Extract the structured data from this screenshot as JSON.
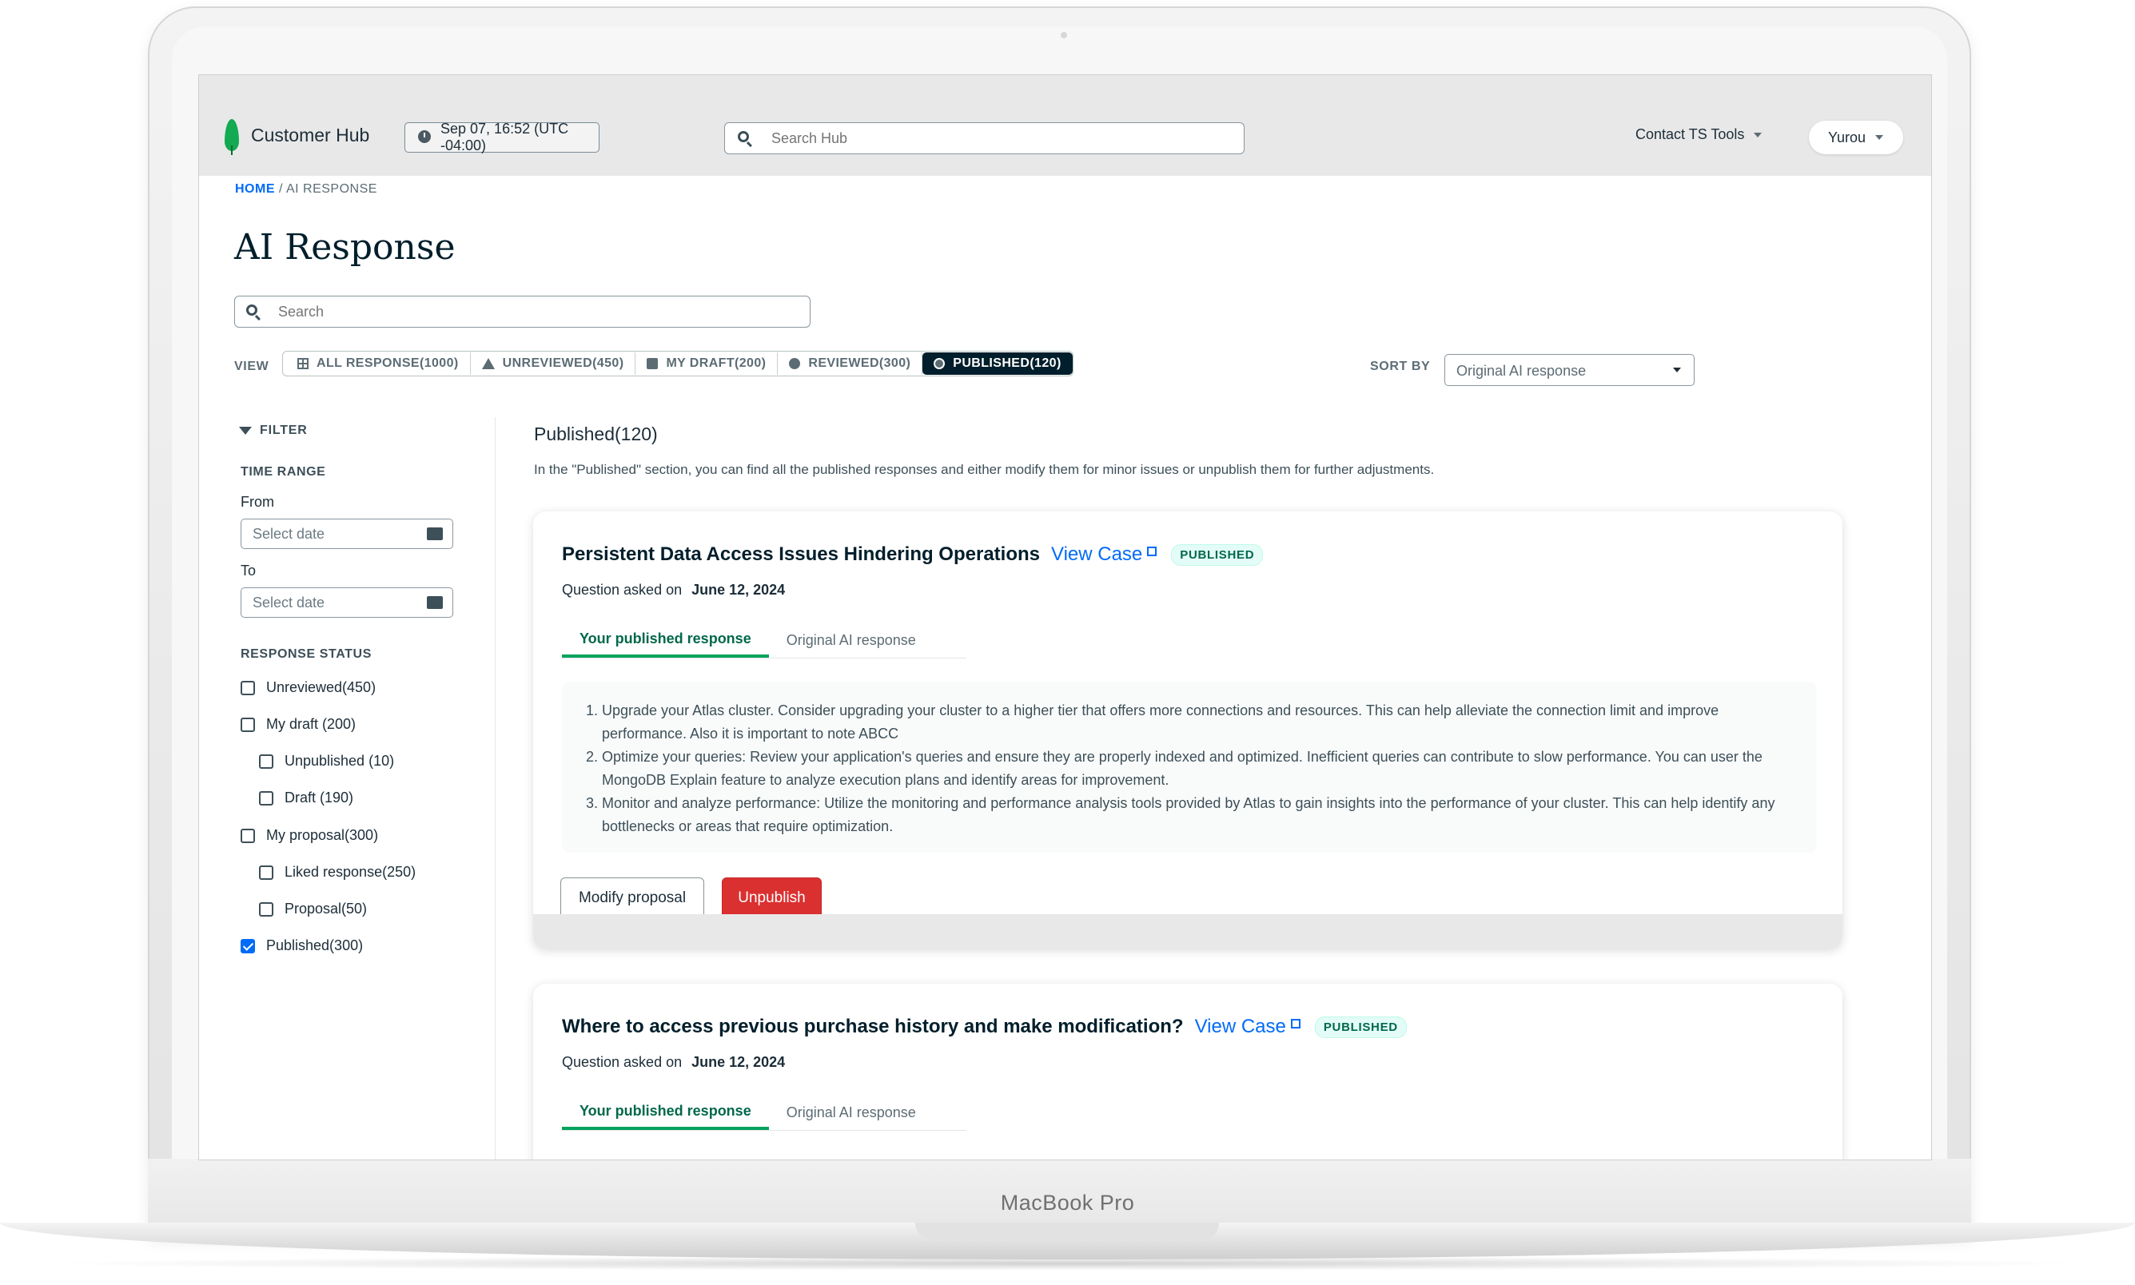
{
  "device": {
    "label": "MacBook Pro"
  },
  "header": {
    "brand": "Customer Hub",
    "datetime": "Sep 07, 16:52 (UTC -04:00)",
    "search_placeholder": "Search Hub",
    "contact_menu": "Contact TS Tools",
    "user_menu": "Yurou"
  },
  "breadcrumb": {
    "home": "HOME",
    "separator": "/",
    "current": "AI RESPONSE"
  },
  "page": {
    "title": "AI Response",
    "search_placeholder": "Search"
  },
  "view": {
    "label": "VIEW",
    "tabs": [
      {
        "label": "ALL RESPONSE(1000)",
        "icon": "grid-icon"
      },
      {
        "label": "UNREVIEWED(450)",
        "icon": "warning-icon"
      },
      {
        "label": "MY DRAFT(200)",
        "icon": "draft-icon"
      },
      {
        "label": "REVIEWED(300)",
        "icon": "check-circle-icon"
      },
      {
        "label": "PUBLISHED(120)",
        "icon": "published-icon",
        "active": true
      }
    ]
  },
  "sort": {
    "label": "SORT BY",
    "selected": "Original AI response"
  },
  "filter": {
    "heading": "FILTER",
    "time_range": {
      "heading": "TIME RANGE",
      "from_label": "From",
      "from_placeholder": "Select date",
      "to_label": "To",
      "to_placeholder": "Select date"
    },
    "response_status": {
      "heading": "RESPONSE STATUS",
      "items": [
        {
          "label": "Unreviewed(450)",
          "checked": false,
          "indent": 0
        },
        {
          "label": "My draft (200)",
          "checked": false,
          "indent": 0
        },
        {
          "label": "Unpublished (10)",
          "checked": false,
          "indent": 1
        },
        {
          "label": "Draft (190)",
          "checked": false,
          "indent": 1
        },
        {
          "label": "My proposal(300)",
          "checked": false,
          "indent": 0
        },
        {
          "label": "Liked response(250)",
          "checked": false,
          "indent": 1
        },
        {
          "label": "Proposal(50)",
          "checked": false,
          "indent": 1
        },
        {
          "label": "Published(300)",
          "checked": true,
          "indent": 0
        }
      ]
    }
  },
  "main": {
    "title": "Published(120)",
    "description": "In the \"Published\" section, you can find all the published responses and either modify them for minor issues or unpublish them for further adjustments.",
    "cards": [
      {
        "title": "Persistent Data Access Issues Hindering Operations",
        "view_case": "View Case",
        "badge": "PUBLISHED",
        "asked_label": "Question asked on",
        "asked_date": "June 12, 2024",
        "tabs": [
          "Your published response",
          "Original AI response"
        ],
        "answers": [
          "Upgrade your Atlas cluster. Consider upgrading your cluster to a higher tier that offers more connections and resources. This can help alleviate the connection limit and improve performance. Also it is important to note ABCC",
          "Optimize your queries: Review your application's queries and ensure they are properly indexed and optimized. Inefficient queries can contribute to slow performance. You can user the MongoDB Explain feature to analyze execution plans and identify areas for improvement.",
          "Monitor and analyze performance: Utilize the monitoring and performance analysis tools provided by Atlas to gain insights into the performance of your cluster. This can help identify any bottlenecks or areas that require optimization."
        ],
        "modify_label": "Modify proposal",
        "unpublish_label": "Unpublish"
      },
      {
        "title": "Where to access previous purchase history and make modification?",
        "view_case": "View Case",
        "badge": "PUBLISHED",
        "asked_label": "Question asked on",
        "asked_date": "June 12, 2024",
        "tabs": [
          "Your published response",
          "Original AI response"
        ]
      }
    ]
  },
  "colors": {
    "accent_green": "#00a35c",
    "link_blue": "#016bf8",
    "danger_red": "#db3030",
    "dark_navy": "#001e2b"
  }
}
